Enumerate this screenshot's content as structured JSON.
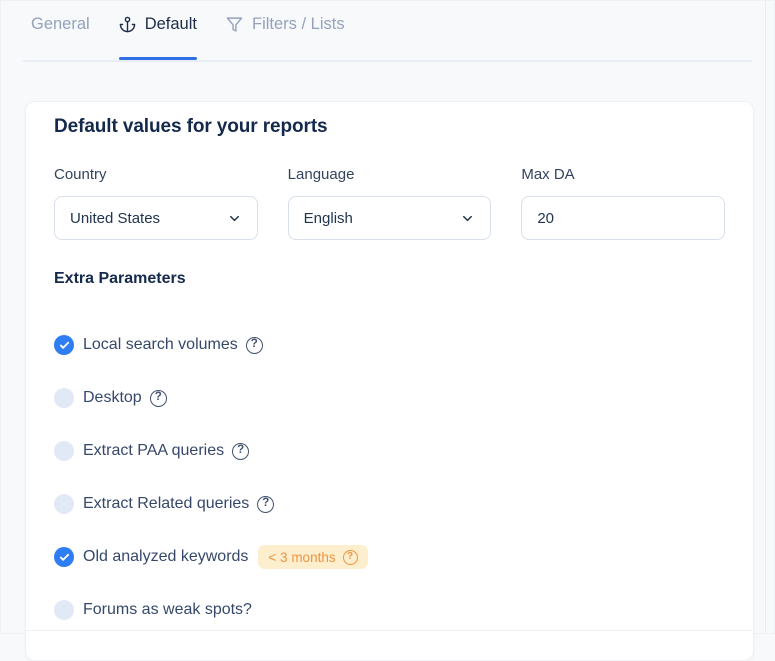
{
  "tabs": {
    "items": [
      {
        "label": "General",
        "active": false,
        "icon": null
      },
      {
        "label": "Default",
        "active": true,
        "icon": "anchor-icon"
      },
      {
        "label": "Filters / Lists",
        "active": false,
        "icon": "funnel-icon"
      }
    ]
  },
  "panel": {
    "title": "Default values for your reports",
    "fields": [
      {
        "label": "Country",
        "value": "United States",
        "control": "select"
      },
      {
        "label": "Language",
        "value": "English",
        "control": "select"
      },
      {
        "label": "Max DA",
        "value": "20",
        "control": "text-input"
      }
    ],
    "extra_parameters": {
      "title": "Extra Parameters",
      "options": [
        {
          "label": "Local search volumes",
          "checked": true,
          "help": true
        },
        {
          "label": "Desktop",
          "checked": false,
          "help": true
        },
        {
          "label": "Extract PAA queries",
          "checked": false,
          "help": true
        },
        {
          "label": "Extract Related queries",
          "checked": false,
          "help": true
        },
        {
          "label": "Old analyzed keywords",
          "checked": true,
          "help": false,
          "badge": {
            "text": "< 3 months",
            "help": true
          }
        },
        {
          "label": "Forums as weak spots?",
          "checked": false,
          "help": false
        }
      ]
    }
  },
  "glyphs": {
    "question": "?"
  },
  "icons": {
    "tab_default": "anchor-icon",
    "tab_filters": "funnel-icon",
    "select_caret": "chevron-down-icon",
    "checkbox_check": "check-icon",
    "help": "question-circle-icon"
  },
  "colors": {
    "page_bg": "#f7f9fb",
    "accent_blue": "#2e7df2",
    "tab_underline": "#2f6fe4",
    "unchecked_fill": "#e2e9f6",
    "badge_bg": "#fdeecd",
    "badge_text": "#ee9440",
    "heading_text": "#14294b",
    "muted_tab_text": "#95a2ba"
  }
}
